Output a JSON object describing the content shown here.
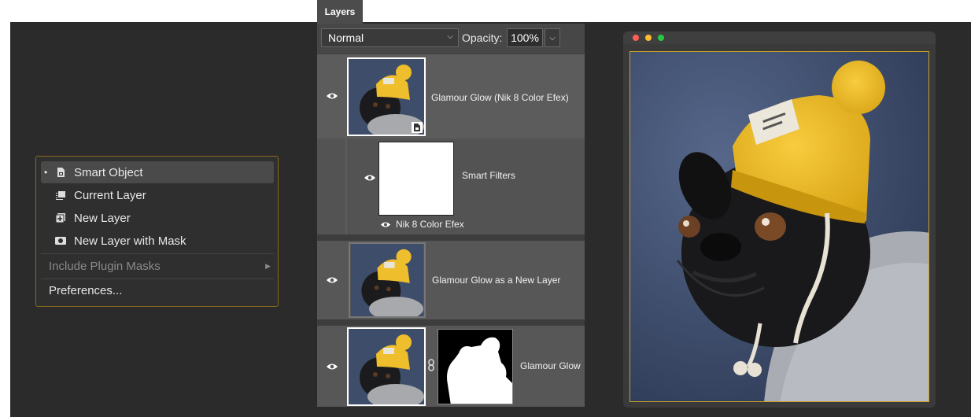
{
  "menu": {
    "items": [
      {
        "label": "Smart Object",
        "icon": "smart-object-icon",
        "selected": true
      },
      {
        "label": "Current Layer",
        "icon": "current-layer-icon"
      },
      {
        "label": "New Layer",
        "icon": "new-layer-icon"
      },
      {
        "label": "New Layer with Mask",
        "icon": "mask-icon"
      }
    ],
    "include_plugin_masks": "Include Plugin Masks",
    "preferences": "Preferences..."
  },
  "layers": {
    "tab_label": "Layers",
    "blend_mode": "Normal",
    "opacity_label": "Opacity:",
    "opacity_value": "100%",
    "rows": [
      {
        "name": "Glamour Glow (Nik 8 Color Efex)"
      },
      {
        "name": "Smart Filters",
        "filter": "Nik 8 Color Efex"
      },
      {
        "name": "Glamour Glow as a New Layer"
      },
      {
        "name": "Glamour Glow"
      }
    ]
  },
  "colors": {
    "accent": "#c9a227",
    "hat": "#f2c12e",
    "background": "#2b2b2b"
  }
}
